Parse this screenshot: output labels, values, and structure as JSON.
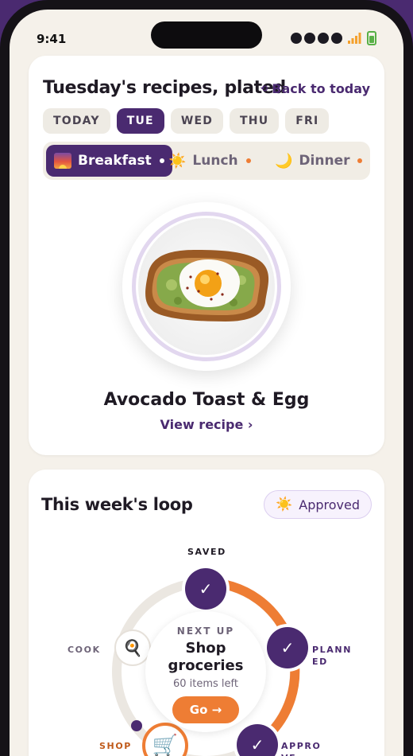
{
  "status_bar": {
    "time": "9:41"
  },
  "recipes_card": {
    "title": "Tuesday's recipes, plated",
    "back_link": "Back to today",
    "day_tabs": [
      {
        "label": "TODAY",
        "active": false
      },
      {
        "label": "TUE",
        "active": true
      },
      {
        "label": "WED",
        "active": false
      },
      {
        "label": "THU",
        "active": false
      },
      {
        "label": "FRI",
        "active": false
      }
    ],
    "meal_tabs": [
      {
        "label": "Breakfast",
        "icon": "sunrise-icon",
        "active": true
      },
      {
        "label": "Lunch",
        "icon": "sun-icon",
        "active": false
      },
      {
        "label": "Dinner",
        "icon": "moon-icon",
        "active": false
      }
    ],
    "recipe_name": "Avocado Toast & Egg",
    "view_recipe": "View recipe ›"
  },
  "loop_card": {
    "title": "This week's loop",
    "badge": "Approved",
    "steps": {
      "saved": "SAVED",
      "planned": "PLANN\nED",
      "approve": "APPRO\nVE",
      "shop": "SHOP",
      "cook": "COOK"
    },
    "next": {
      "kicker": "NEXT UP",
      "title": "Shop groceries",
      "subtitle": "60 items left",
      "button": "Go →"
    }
  },
  "colors": {
    "brand_purple": "#4a2a70",
    "accent_orange": "#ee7d34",
    "background": "#f5f1ea"
  }
}
